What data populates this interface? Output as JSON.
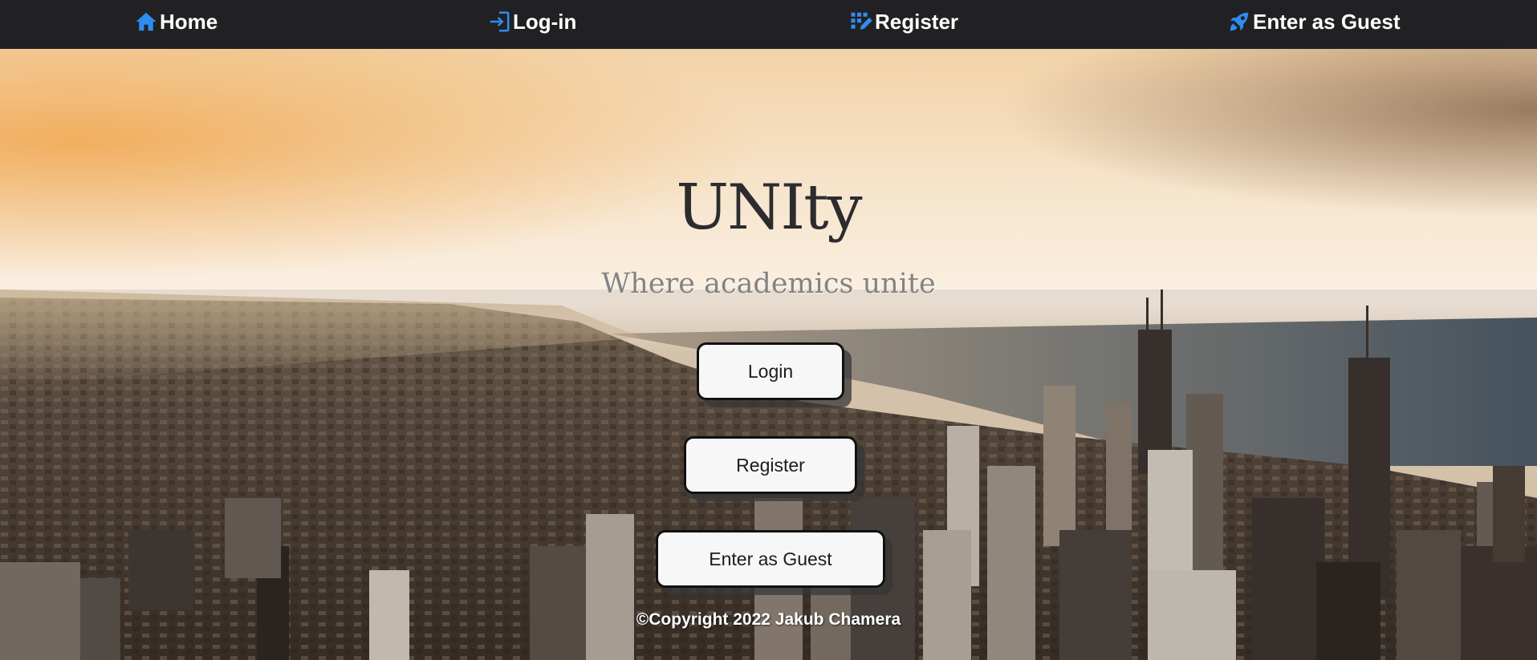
{
  "nav": {
    "home": {
      "label": "Home",
      "icon": "home-icon"
    },
    "login": {
      "label": "Log-in",
      "icon": "login-icon"
    },
    "register": {
      "label": "Register",
      "icon": "register-icon"
    },
    "guest": {
      "label": "Enter as Guest",
      "icon": "rocket-icon"
    }
  },
  "hero": {
    "title": "UNIty",
    "subtitle": "Where academics unite",
    "buttons": {
      "login": "Login",
      "register": "Register",
      "guest": "Enter as Guest"
    },
    "background": "city-skyline-sunset-photo"
  },
  "footer": {
    "copyright": "©Copyright 2022 Jakub Chamera"
  },
  "colors": {
    "nav_bg": "#212124",
    "icon_accent": "#2f8cf0",
    "button_bg": "#f7f7f7",
    "title": "#2c2c2e"
  }
}
